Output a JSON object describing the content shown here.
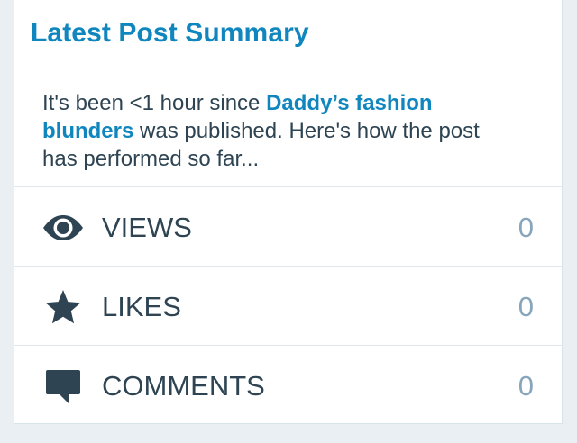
{
  "card": {
    "title": "Latest Post Summary",
    "summary_before": "It's been <1 hour since ",
    "post_title": "Daddy’s fashion blunders",
    "summary_after": " was published. Here's how the post has performed so far..."
  },
  "stats": [
    {
      "label": "VIEWS",
      "value": "0",
      "icon": "eye-icon"
    },
    {
      "label": "LIKES",
      "value": "0",
      "icon": "star-icon"
    },
    {
      "label": "COMMENTS",
      "value": "0",
      "icon": "comment-icon"
    }
  ],
  "colors": {
    "accent": "#0f86be",
    "text": "#2e4453",
    "muted_value": "#87a6bc",
    "background": "#e9eff3"
  }
}
